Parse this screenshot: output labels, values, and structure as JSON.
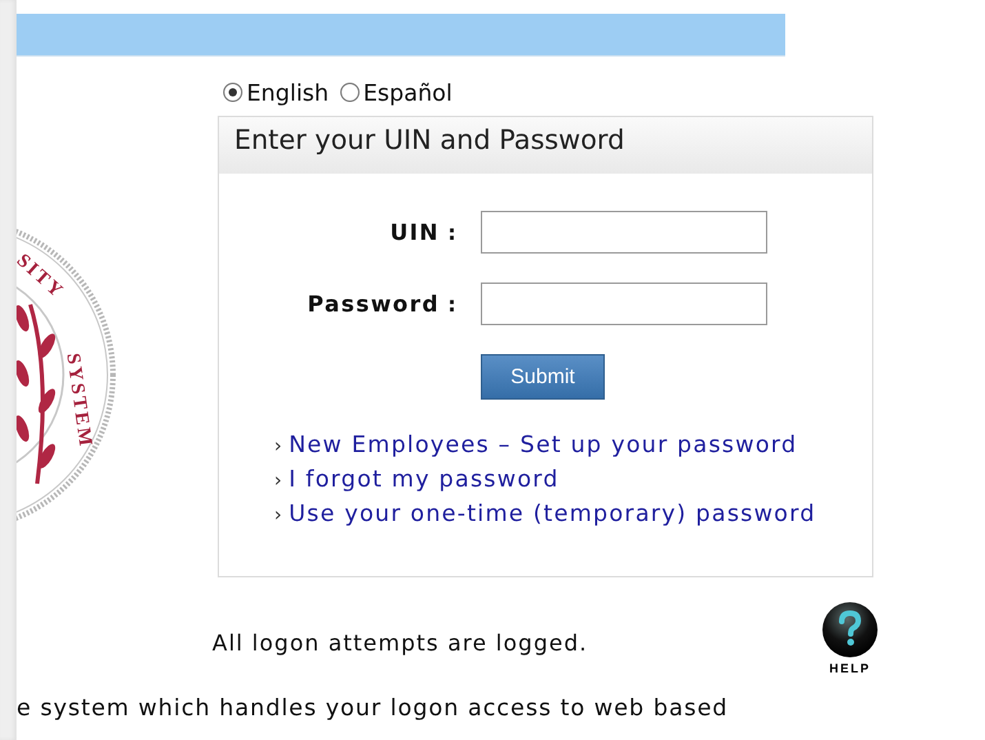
{
  "seal": {
    "words": [
      "SITY",
      "SYSTEM"
    ]
  },
  "languages": [
    {
      "label": "English",
      "selected": true
    },
    {
      "label": "Español",
      "selected": false
    }
  ],
  "login_panel": {
    "title": "Enter your UIN and Password",
    "fields": [
      {
        "label": "UIN",
        "separator": ":"
      },
      {
        "label": "Password",
        "separator": ":"
      }
    ],
    "submit": "Submit",
    "links": [
      {
        "marker": "›",
        "text": "New Employees – Set up your password"
      },
      {
        "marker": "›",
        "text": "I forgot my password"
      },
      {
        "marker": "›",
        "text": "Use your one-time (temporary) password"
      }
    ]
  },
  "notice": "All logon attempts are logged.",
  "help": {
    "label": "HELP"
  },
  "footer_text": "e system which handles your logon access to web based"
}
